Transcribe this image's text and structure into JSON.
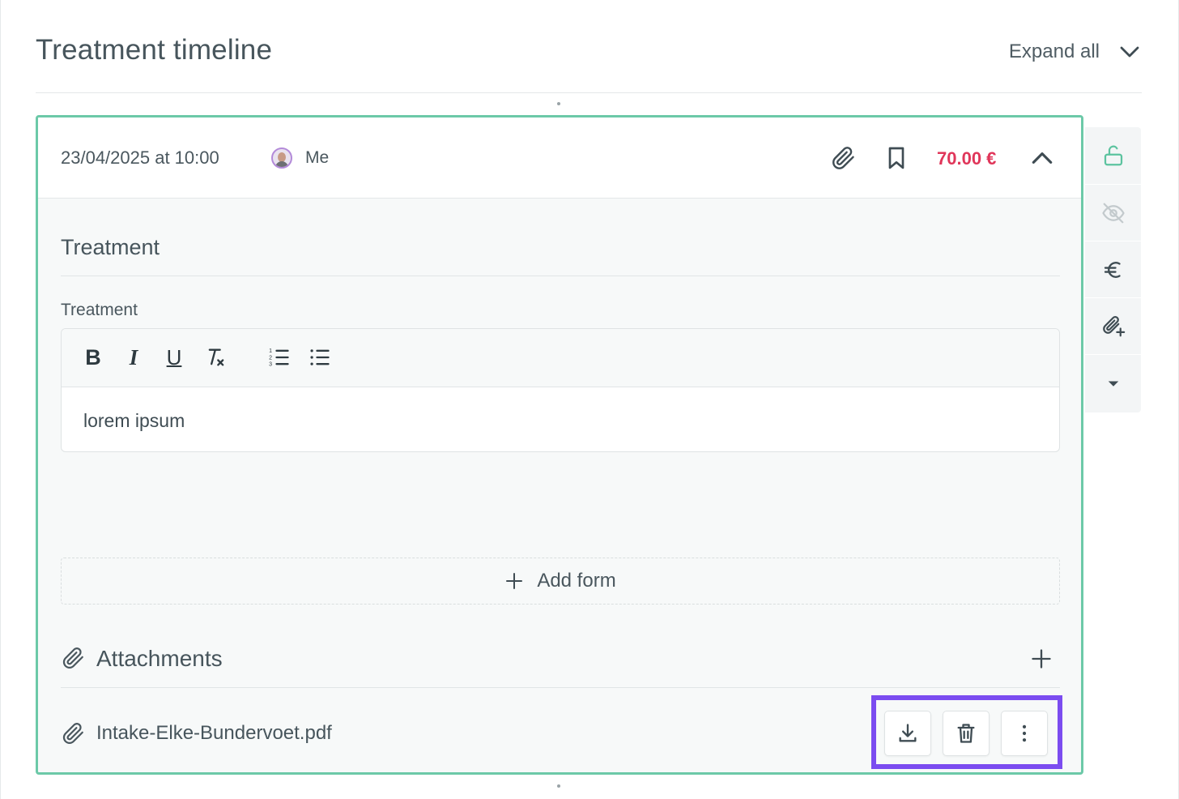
{
  "header": {
    "title": "Treatment timeline",
    "expand_all_label": "Expand all",
    "expand_icon": "chevron-down-icon"
  },
  "entry": {
    "date": "23/04/2025 at 10:00",
    "user": "Me",
    "price": "70.00 €",
    "price_color": "#e0365a",
    "accent_color": "#6cc9a8",
    "icons": [
      "paperclip-icon",
      "bookmark-icon",
      "chevron-up-icon"
    ]
  },
  "treatment": {
    "section_title": "Treatment",
    "field_label": "Treatment",
    "toolbar": [
      "bold-icon",
      "italic-icon",
      "underline-icon",
      "clear-format-icon",
      "ordered-list-icon",
      "bullet-list-icon"
    ],
    "toolbar_labels": {
      "bold": "B",
      "italic": "I",
      "underline": "U"
    },
    "content": "lorem ipsum"
  },
  "add_form": {
    "label": "Add form"
  },
  "attachments": {
    "title": "Attachments",
    "files": [
      {
        "name": "Intake-Elke-Bundervoet.pdf",
        "actions": [
          "download-icon",
          "trash-icon",
          "more-vertical-icon"
        ]
      }
    ]
  },
  "side_actions": [
    "unlock-icon",
    "eye-off-icon",
    "euro-icon",
    "attach-add-icon",
    "caret-down-icon"
  ],
  "highlight_color": "#7b4cf0"
}
